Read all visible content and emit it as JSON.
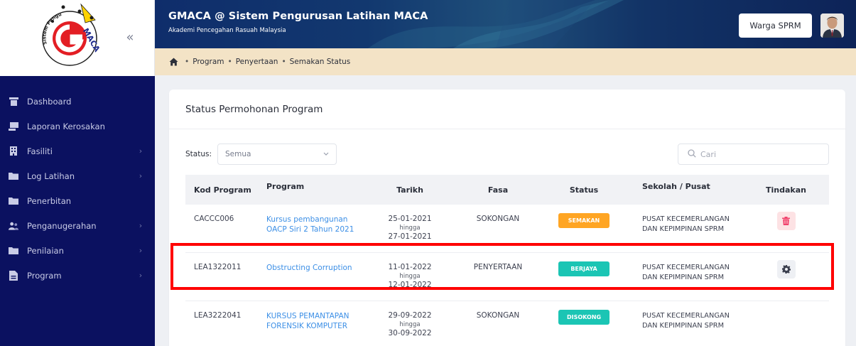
{
  "sidebar": {
    "logo_alt": "Sistem Pengurusan Latihan MACA",
    "collapse_glyph": "«",
    "items": [
      {
        "label": "Dashboard",
        "icon": "dashboard-icon",
        "has_children": false
      },
      {
        "label": "Laporan Kerosakan",
        "icon": "laptop-icon",
        "has_children": false
      },
      {
        "label": "Fasiliti",
        "icon": "building-icon",
        "has_children": true
      },
      {
        "label": "Log Latihan",
        "icon": "folder-icon",
        "has_children": true
      },
      {
        "label": "Penerbitan",
        "icon": "folder-icon",
        "has_children": false
      },
      {
        "label": "Penganugerahan",
        "icon": "users-icon",
        "has_children": true
      },
      {
        "label": "Penilaian",
        "icon": "folder-icon",
        "has_children": true
      },
      {
        "label": "Program",
        "icon": "file-icon",
        "has_children": true
      }
    ]
  },
  "header": {
    "title": "GMACA @ Sistem Pengurusan Latihan MACA",
    "subtitle": "Akademi Pencegahan Rasuah Malaysia",
    "user_button": "Warga SPRM"
  },
  "breadcrumb": {
    "items": [
      "Program",
      "Penyertaan",
      "Semakan Status"
    ],
    "separator": "•"
  },
  "card": {
    "title": "Status Permohonan Program",
    "filter_label": "Status:",
    "filter_value": "Semua",
    "search_placeholder": "Cari"
  },
  "table": {
    "columns": [
      "Kod Program",
      "Program",
      "Tarikh",
      "Fasa",
      "Status",
      "Sekolah / Pusat",
      "Tindakan"
    ],
    "date_joiner": "hingga",
    "rows": [
      {
        "code": "CACCC006",
        "program": "Kursus pembangunan OACP Siri 2 Tahun 2021",
        "date_from": "25-01-2021",
        "date_to": "27-01-2021",
        "phase": "SOKONGAN",
        "status": "SEMAKAN",
        "status_color": "#ffa523",
        "school": "PUSAT KECEMERLANGAN DAN KEPIMPINAN SPRM",
        "action": "delete"
      },
      {
        "code": "LEA1322011",
        "program": "Obstructing Corruption",
        "date_from": "11-01-2022",
        "date_to": "12-01-2022",
        "phase": "PENYERTAAN",
        "status": "BERJAYA",
        "status_color": "#1bc5b4",
        "school": "PUSAT KECEMERLANGAN DAN KEPIMPINAN SPRM",
        "action": "settings"
      },
      {
        "code": "LEA3222041",
        "program": "KURSUS PEMANTAPAN FORENSIK KOMPUTER",
        "date_from": "29-09-2022",
        "date_to": "30-09-2022",
        "phase": "SOKONGAN",
        "status": "DISOKONG",
        "status_color": "#1bc5b4",
        "school": "PUSAT KECEMERLANGAN DAN KEPIMPINAN SPRM",
        "action": "none"
      }
    ]
  },
  "colors": {
    "sidebar_bg": "#0b1160",
    "breadcrumb_bg": "#f3e3c6",
    "link": "#3c8fe6",
    "badge_warning": "#ffa523",
    "badge_success": "#1bc5b4",
    "delete_btn_bg": "#fde2e4",
    "delete_btn_icon": "#f1416c",
    "settings_btn_bg": "#eef0f4",
    "highlight": "#ff0000"
  }
}
